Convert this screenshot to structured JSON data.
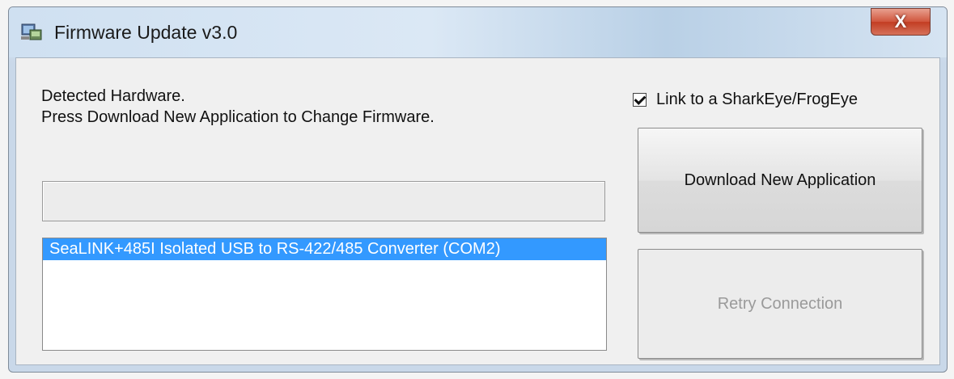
{
  "window": {
    "title": "Firmware Update v3.0",
    "close_label": "X"
  },
  "message": {
    "line1": "Detected Hardware.",
    "line2": "Press Download New Application to Change Firmware."
  },
  "progress": {
    "value": 0
  },
  "devices": {
    "items": [
      {
        "label": "SeaLINK+485I Isolated USB to RS-422/485 Converter (COM2)",
        "selected": true
      }
    ]
  },
  "options": {
    "link_label": "Link to a SharkEye/FrogEye",
    "link_checked": true
  },
  "buttons": {
    "download_label": "Download New Application",
    "retry_label": "Retry Connection"
  },
  "colors": {
    "selection": "#3399ff",
    "close_button": "#c23d22"
  }
}
